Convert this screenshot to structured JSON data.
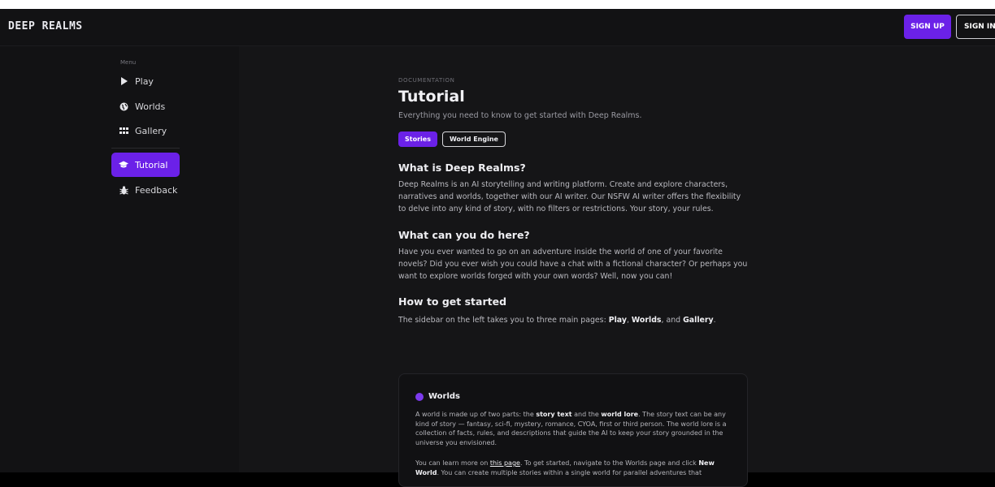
{
  "header": {
    "logo": "DEEP REALMS",
    "sign_up": "SIGN UP",
    "sign_in": "SIGN IN"
  },
  "sidebar": {
    "menu_label": "Menu",
    "items": [
      {
        "label": "Play",
        "icon": "play-icon"
      },
      {
        "label": "Worlds",
        "icon": "globe-icon"
      },
      {
        "label": "Gallery",
        "icon": "gallery-icon"
      },
      {
        "label": "Tutorial",
        "icon": "graduation-cap-icon",
        "active": true
      },
      {
        "label": "Feedback",
        "icon": "bug-icon"
      }
    ]
  },
  "page": {
    "eyebrow": "DOCUMENTATION",
    "title": "Tutorial",
    "subtitle": "Everything you need to know to get started with Deep Realms.",
    "tabs": [
      "Stories",
      "World Engine"
    ]
  },
  "sections": {
    "what_is": {
      "heading": "What is Deep Realms?",
      "body": "Deep Realms is an AI storytelling and writing platform. Create and explore characters, narratives and worlds, together with our AI writer. Our NSFW AI writer offers the flexibility to delve into any kind of story, with no filters or restrictions. Your story, your rules."
    },
    "what_can": {
      "heading": "What can you do here?",
      "body": "Have you ever wanted to go on an adventure inside the world of one of your favorite novels? Did you ever wish you could have a chat with a fictional character? Or perhaps you want to explore worlds forged with your own words? Well, now you can!"
    },
    "how_to": {
      "heading": "How to get started",
      "intro": "The sidebar on the left takes you to three main pages: ",
      "play": "Play",
      "sep1": ", ",
      "worlds": "Worlds",
      "sep2": ", and ",
      "gallery": "Gallery",
      "end": "."
    }
  },
  "worlds_card": {
    "title": "Worlds",
    "p1_a": "A world is made up of two parts: the ",
    "p1_b": "story text",
    "p1_c": " and the ",
    "p1_d": "world lore",
    "p1_e": ". The story text can be any kind of story — fantasy, sci-fi, mystery, romance, CYOA, first or third person. The world lore is a collection of facts, rules, and descriptions that guide the AI to keep your story grounded in the universe you envisioned.",
    "p2_a": "You can learn more on ",
    "p2_link": "this page",
    "p2_b": ". To get started, navigate to the Worlds page and click ",
    "p2_c": "New World",
    "p2_d": ". You can create multiple stories within a single world for parallel adventures that"
  },
  "colors": {
    "accent": "#6b21e8",
    "background": "#151517",
    "sidebar": "#121214"
  }
}
